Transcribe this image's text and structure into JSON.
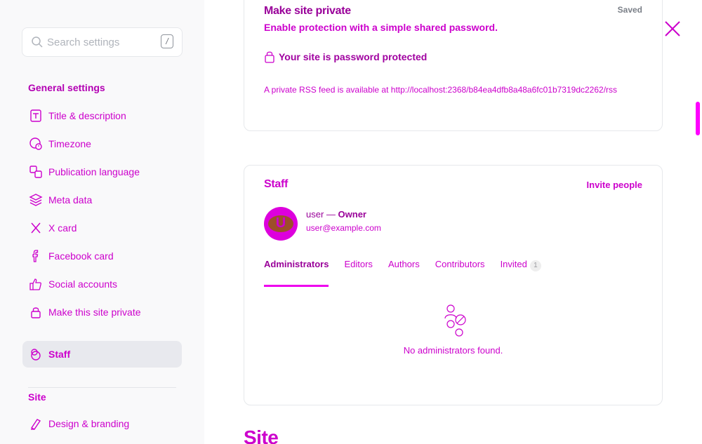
{
  "sidebar": {
    "search": {
      "placeholder": "Search settings",
      "shortcut": "/"
    },
    "general_title": "General settings",
    "items": [
      {
        "label": "Title & description",
        "icon": "title-icon"
      },
      {
        "label": "Timezone",
        "icon": "timezone-icon"
      },
      {
        "label": "Publication language",
        "icon": "language-icon"
      },
      {
        "label": "Meta data",
        "icon": "meta-data-icon"
      },
      {
        "label": "X card",
        "icon": "x-icon"
      },
      {
        "label": "Facebook card",
        "icon": "facebook-icon"
      },
      {
        "label": "Social accounts",
        "icon": "thumbs-up-icon"
      },
      {
        "label": "Make this site private",
        "icon": "lock-icon"
      },
      {
        "label": "Staff",
        "icon": "staff-icon",
        "active": true
      }
    ],
    "site_title": "Site",
    "site_items": [
      {
        "label": "Design & branding",
        "icon": "brush-icon"
      }
    ]
  },
  "private_card": {
    "title": "Make site private",
    "status": "Saved",
    "subtitle": "Enable protection with a simple shared password.",
    "protected_text": "Your site is password protected",
    "rss_text": "A private RSS feed is available at http://localhost:2368/b84ea4dfb8a48a6fc01b7319dc2262/rss"
  },
  "staff_card": {
    "title": "Staff",
    "invite_label": "Invite people",
    "user": {
      "initial": "U",
      "name": "user",
      "separator": " — ",
      "role": "Owner",
      "email": "user@example.com"
    },
    "tabs": [
      {
        "label": "Administrators",
        "active": true
      },
      {
        "label": "Editors"
      },
      {
        "label": "Authors"
      },
      {
        "label": "Contributors"
      },
      {
        "label": "Invited",
        "count": "1"
      }
    ],
    "empty_text": "No administrators found."
  },
  "next_section_title": "Site",
  "colors": {
    "accent": "#cc00cc",
    "active_tab_underline": "#ee00ee",
    "scrollbar": "#ff00ff"
  }
}
